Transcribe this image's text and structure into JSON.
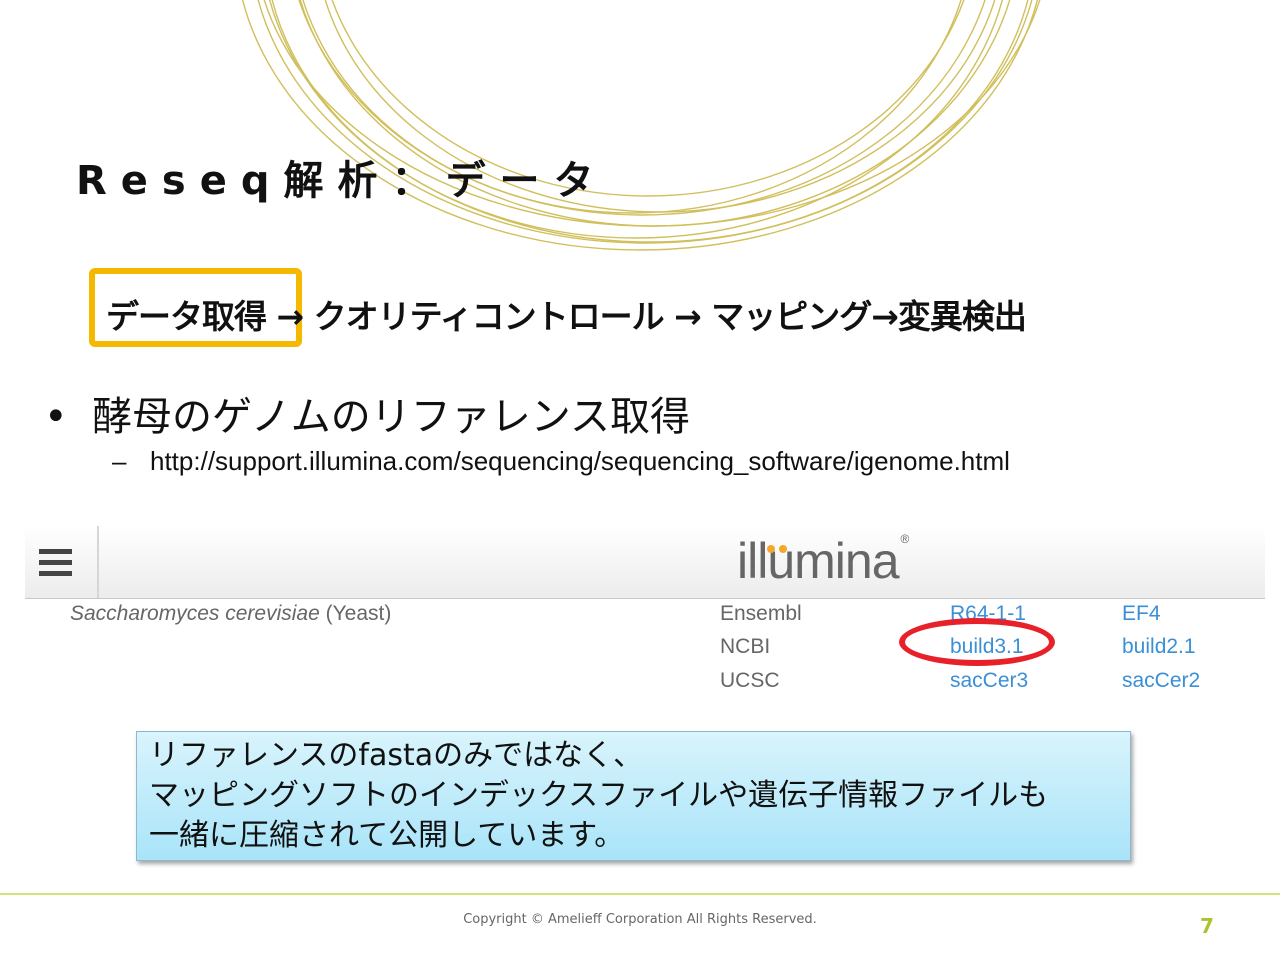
{
  "slide": {
    "title": "Reseq解析：データ",
    "flow": {
      "step1": "データ取得",
      "rest": " → クオリティコントロール → マッピング→変異検出"
    },
    "bullet": "酵母のゲノムのリファレンス取得",
    "sub_bullet": "http://support.illumina.com/sequencing/sequencing_software/igenome.html",
    "note": {
      "line1": "リファレンスのfastaのみではなく、",
      "line2": "マッピングソフトのインデックスファイルや遺伝子情報ファイルも",
      "line3": "一緒に圧縮されて公開しています。"
    },
    "copyright": "Copyright © Amelieff Corporation All Rights Reserved.",
    "page_number": "7",
    "colors": {
      "highlight_box": "#f5b800",
      "link": "#3b8fd6",
      "ellipse": "#e8202a",
      "footer_line": "#d3e27a",
      "page_number": "#a8c431"
    }
  },
  "screenshot": {
    "logo": "illumina",
    "menu_icon": "hamburger-icon",
    "species_italic": "Saccharomyces cerevisiae",
    "species_common": "(Yeast)",
    "rows": [
      {
        "source": "Ensembl",
        "build1": "R64-1-1",
        "build2": "EF4"
      },
      {
        "source": "NCBI",
        "build1": "build3.1",
        "build2": "build2.1"
      },
      {
        "source": "UCSC",
        "build1": "sacCer3",
        "build2": "sacCer2"
      }
    ]
  }
}
